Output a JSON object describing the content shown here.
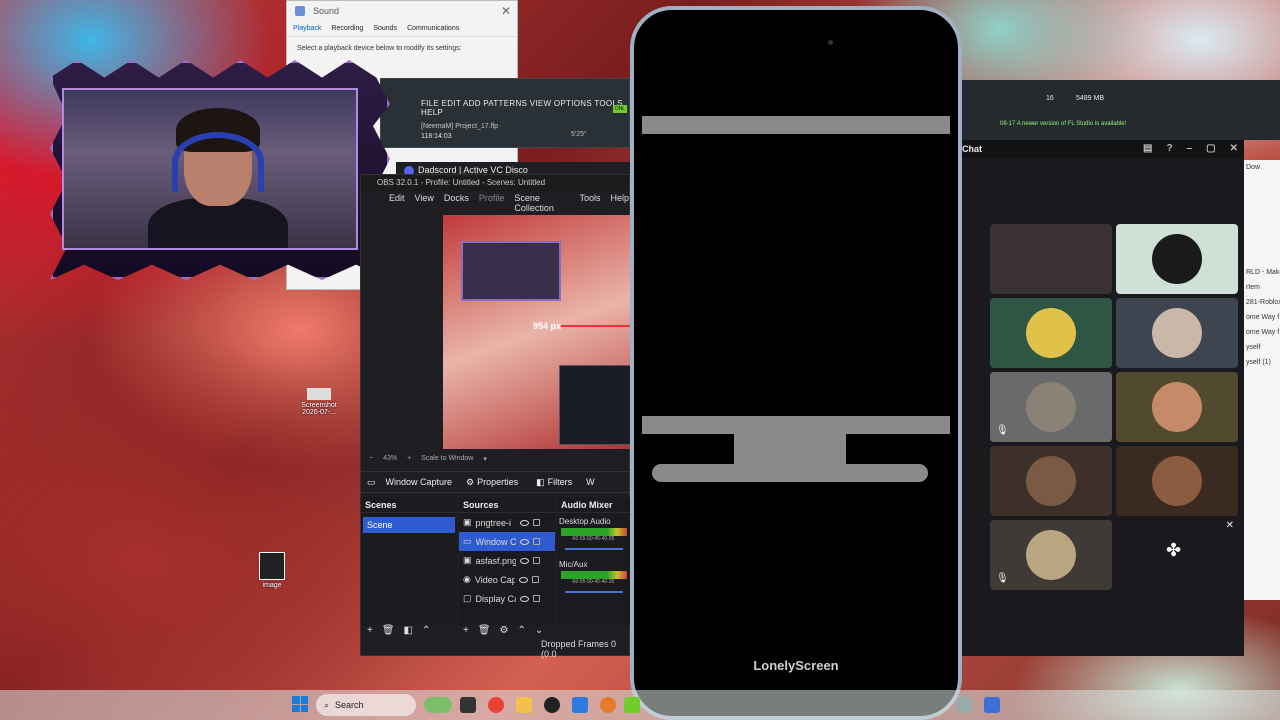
{
  "sound": {
    "title": "Sound",
    "tabs": [
      "Playback",
      "Recording",
      "Sounds",
      "Communications"
    ],
    "description": "Select a playback device below to modify its settings:"
  },
  "fl": {
    "menu": "FILE EDIT ADD PATTERNS VIEW OPTIONS TOOLS HELP",
    "project": "[NeemaM] Project_17.flp",
    "time": "118:14:03",
    "beats": "5'25\"",
    "badge": "ONL"
  },
  "discord_strip": {
    "title": "Dadscord | Active VC Disco"
  },
  "obs": {
    "title": "OBS 32.0.1 - Profile: Untitled - Scenes: Untitled",
    "menu": [
      "Edit",
      "View",
      "Docks",
      "Profile",
      "Scene Collection",
      "Tools",
      "Help"
    ],
    "preview_label": "954 px",
    "zoom": {
      "minus": "−",
      "value": "43%",
      "plus": "+",
      "mode": "Scale to Window"
    },
    "source_bar": {
      "name": "Window Capture",
      "properties": "Properties",
      "filters": "Filters",
      "more": "W"
    },
    "scenes": {
      "header": "Scenes",
      "items": [
        "Scene"
      ]
    },
    "sources": {
      "header": "Sources",
      "items": [
        {
          "name": "pngtree-i"
        },
        {
          "name": "Window C"
        },
        {
          "name": "asfasf.png"
        },
        {
          "name": "Video Cap"
        },
        {
          "name": "Display Ca"
        }
      ]
    },
    "mixer": {
      "header": "Audio Mixer",
      "channels": [
        {
          "name": "Desktop Audio",
          "ticks": "-60-55-50-45-40-35"
        },
        {
          "name": "Mic/Aux",
          "ticks": "-60-55-50-45-40-35"
        }
      ]
    },
    "status": "Dropped Frames 0 (0.0"
  },
  "phone": {
    "brand": "LonelyScreen"
  },
  "fl_right": {
    "num": "16",
    "mem": "5489 MB",
    "news_date": "08-17",
    "news": "A newer version of FL Studio is available!"
  },
  "discord_call": {
    "title": "Chat"
  },
  "edge": {
    "items": [
      "Dow",
      "RLD - Make",
      "rtem",
      "281-Roblox",
      "ome Way f",
      "ome Way f",
      "yself",
      "yself (1)"
    ]
  },
  "desktop": {
    "icons": [
      {
        "label": "Screenshot 2026-07-..."
      },
      {
        "label": "image"
      }
    ]
  },
  "taskbar": {
    "search": "Search"
  },
  "colors": {
    "obs_select": "#2f5bd0",
    "discord_accent": "#5865f2",
    "fl_green": "#6fcf2a"
  }
}
